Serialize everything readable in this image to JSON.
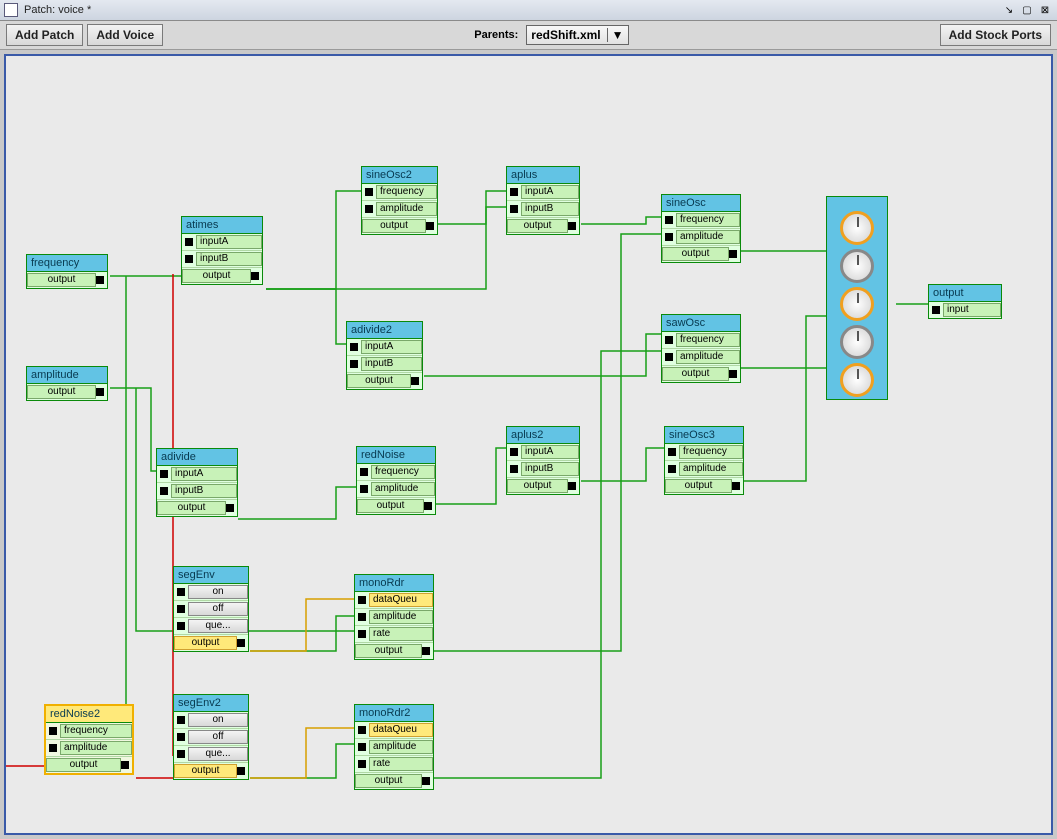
{
  "window": {
    "title": "Patch: voice *"
  },
  "toolbar": {
    "add_patch": "Add Patch",
    "add_voice": "Add Voice",
    "parents_label": "Parents:",
    "parents_value": "redShift.xml",
    "add_stock_ports": "Add Stock Ports"
  },
  "nodes": {
    "frequency": {
      "title": "frequency",
      "out": "output"
    },
    "amplitude": {
      "title": "amplitude",
      "out": "output"
    },
    "atimes": {
      "title": "atimes",
      "inA": "inputA",
      "inB": "inputB",
      "out": "output"
    },
    "sineOsc2": {
      "title": "sineOsc2",
      "freq": "frequency",
      "amp": "amplitude",
      "out": "output"
    },
    "aplus": {
      "title": "aplus",
      "inA": "inputA",
      "inB": "inputB",
      "out": "output"
    },
    "sineOsc": {
      "title": "sineOsc",
      "freq": "frequency",
      "amp": "amplitude",
      "out": "output"
    },
    "adivide2": {
      "title": "adivide2",
      "inA": "inputA",
      "inB": "inputB",
      "out": "output"
    },
    "sawOsc": {
      "title": "sawOsc",
      "freq": "frequency",
      "amp": "amplitude",
      "out": "output"
    },
    "adivide": {
      "title": "adivide",
      "inA": "inputA",
      "inB": "inputB",
      "out": "output"
    },
    "redNoise": {
      "title": "redNoise",
      "freq": "frequency",
      "amp": "amplitude",
      "out": "output"
    },
    "aplus2": {
      "title": "aplus2",
      "inA": "inputA",
      "inB": "inputB",
      "out": "output"
    },
    "sineOsc3": {
      "title": "sineOsc3",
      "freq": "frequency",
      "amp": "amplitude",
      "out": "output"
    },
    "segEnv": {
      "title": "segEnv",
      "on": "on",
      "off": "off",
      "que": "que...",
      "out": "output"
    },
    "monoRdr": {
      "title": "monoRdr",
      "dq": "dataQueu",
      "amp": "amplitude",
      "rate": "rate",
      "out": "output"
    },
    "segEnv2": {
      "title": "segEnv2",
      "on": "on",
      "off": "off",
      "que": "que...",
      "out": "output"
    },
    "monoRdr2": {
      "title": "monoRdr2",
      "dq": "dataQueu",
      "amp": "amplitude",
      "rate": "rate",
      "out": "output"
    },
    "redNoise2": {
      "title": "redNoise2",
      "freq": "frequency",
      "amp": "amplitude",
      "out": "output"
    },
    "output": {
      "title": "output",
      "in": "input"
    }
  }
}
